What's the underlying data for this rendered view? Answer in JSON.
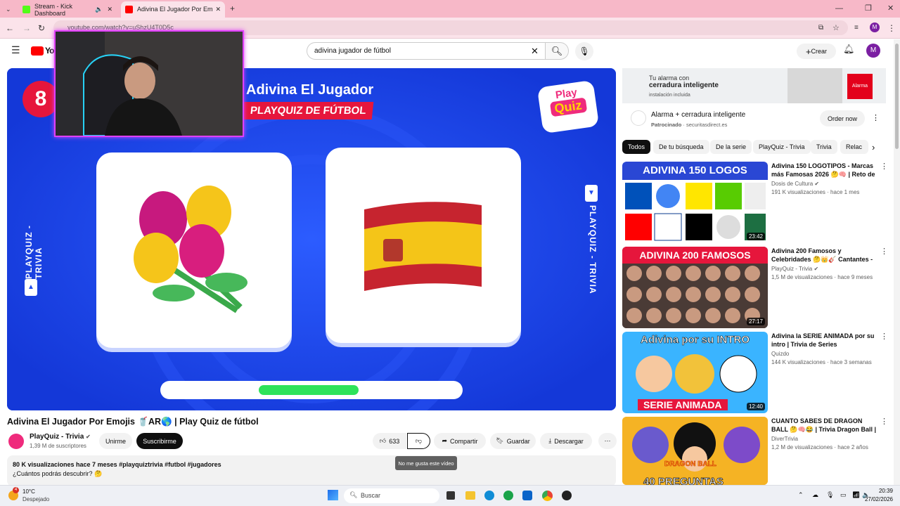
{
  "tabs": [
    {
      "label": "Stream - Kick Dashboard"
    },
    {
      "label": "Adivina El Jugador Por Emojis 🥤"
    }
  ],
  "browser": {
    "url": "youtube.com/watch?v=uShzU4T0D5c",
    "new_tab": "+",
    "profile": "M"
  },
  "yt": {
    "search_value": "adivina jugador de fútbol",
    "create_label": "Crear",
    "avatar": "M",
    "logo": "Yo"
  },
  "video": {
    "overlay_title": "Adivina El Jugador",
    "overlay_subtitle": "PLAYQUIZ DE FÚTBOL",
    "counter": "8",
    "brand_top": "Play",
    "brand_bottom": "Quiz",
    "side_text": "PLAYQUIZ - TRIVIA",
    "progress": 0.33,
    "title": "Adivina El Jugador Por Emojis 🥤AR🌎 | Play Quiz de fútbol"
  },
  "channel": {
    "name": "PlayQuiz - Trivia",
    "subs": "1,39 M de suscriptores",
    "join": "Unirme",
    "subscribe": "Suscribirme"
  },
  "actions": {
    "likes": "633",
    "share": "Compartir",
    "save": "Guardar",
    "download": "Descargar",
    "dislike_tooltip": "No me gusta este vídeo"
  },
  "description": {
    "meta": "80 K visualizaciones  hace 7 meses  #playquiztrivia #futbol #jugadores",
    "text": "¿Cuántos podrás descubrir? 🤔"
  },
  "ad": {
    "banner_line1": "Tu alarma con",
    "banner_line2": "cerradura inteligente",
    "banner_line3": "instalación incluida",
    "badge": "Alarma",
    "title": "Alarma + cerradura inteligente",
    "sponsor": "Patrocinado",
    "domain": "securitasdirect.es",
    "cta": "Order now"
  },
  "chips": [
    "Todos",
    "De tu búsqueda",
    "De la serie",
    "PlayQuiz - Trivia",
    "Trivia",
    "Relac"
  ],
  "recs": [
    {
      "title": "Adivina 150 LOGOTIPOS - Marcas más Famosas 2026 🤔🧠 | Reto de ...",
      "channel": "Dosis de Cultura",
      "meta": "191 K visualizaciones · hace 1 mes",
      "duration": "23:42",
      "banner": "ADIVINA 150 LOGOS"
    },
    {
      "title": "Adivina 200 Famosos y Celebridades 🤔👑🎸 Cantantes - Futbolistas - ...",
      "channel": "PlayQuiz - Trivia",
      "meta": "1,5 M de visualizaciones · hace 9 meses",
      "duration": "27:17",
      "banner": "ADIVINA 200 FAMOSOS"
    },
    {
      "title": "Adivina la SERIE ANIMADA por su intro | Trivia de Series",
      "channel": "Quizdo",
      "meta": "144 K visualizaciones · hace 3 semanas",
      "duration": "12:40",
      "banner": "Adivina por su INTRO",
      "banner2": "SERIE ANIMADA"
    },
    {
      "title": "CUANTO SABES DE DRAGON BALL 🤔🧠😂 | Trivia Dragon Ball | Test ...",
      "channel": "DiverTrivia",
      "meta": "1,2 M de visualizaciones · hace 2 años",
      "duration": "",
      "banner": "40 PREGUNTAS",
      "banner2": "DRAGON BALL"
    }
  ],
  "taskbar": {
    "weather_temp": "10°C",
    "weather_desc": "Despejado",
    "search": "Buscar",
    "time": "20:39",
    "date": "27/02/2026",
    "badge": "4"
  }
}
